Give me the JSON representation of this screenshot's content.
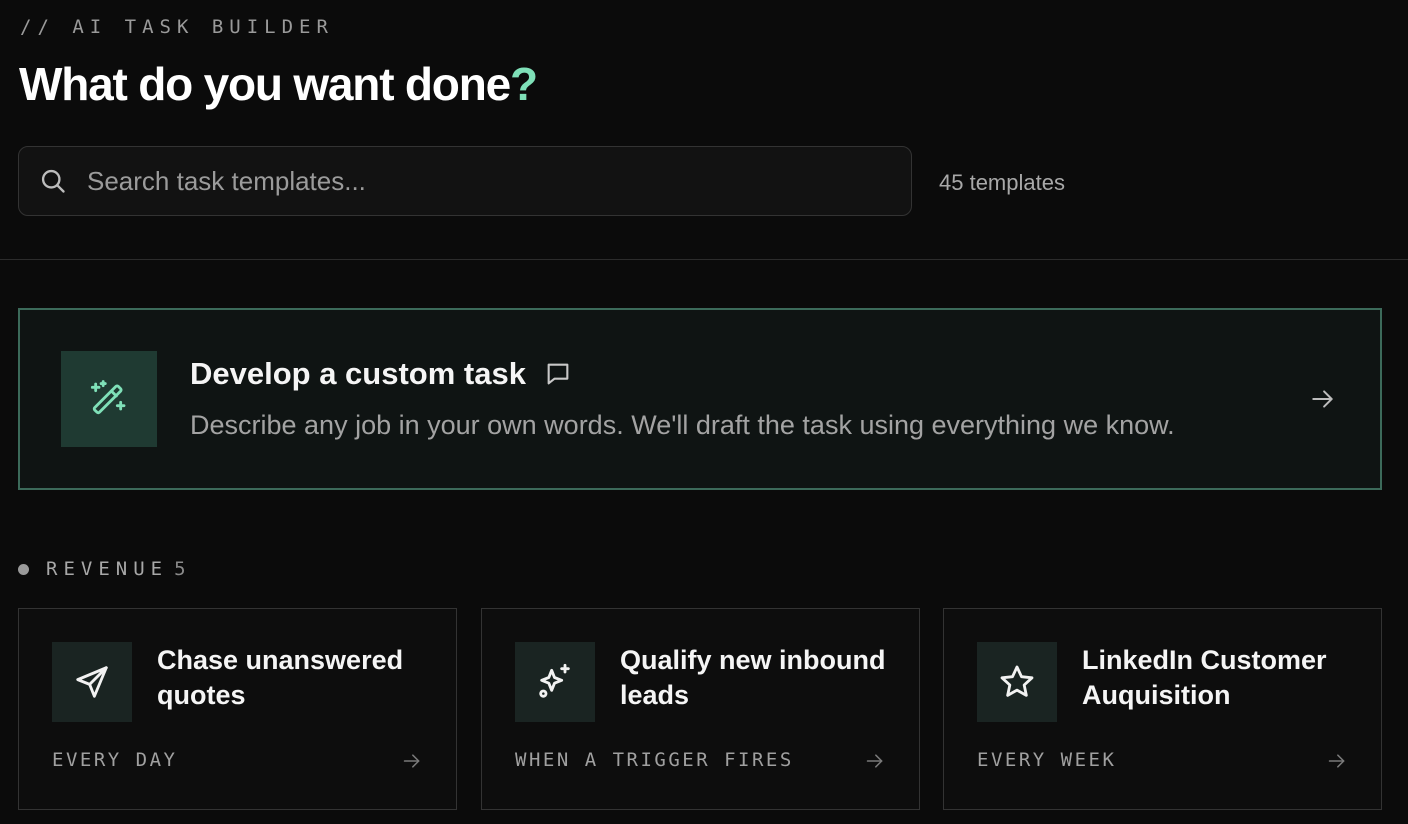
{
  "header": {
    "eyebrow": "// AI TASK BUILDER",
    "title": "What do you want done",
    "title_mark": "?"
  },
  "search": {
    "icon": "search-icon",
    "placeholder": "Search task templates...",
    "value": ""
  },
  "template_count": "45 templates",
  "custom_task": {
    "icon": "magic-wand-icon",
    "title": "Develop a custom task",
    "title_icon": "chat-bubble-icon",
    "description": "Describe any job in your own words. We'll draft the task using everything we know.",
    "arrow_icon": "arrow-right-icon"
  },
  "sections": [
    {
      "label": "REVENUE",
      "count": "5",
      "cards": [
        {
          "icon": "send-icon",
          "title": "Chase unanswered quotes",
          "schedule": "EVERY DAY"
        },
        {
          "icon": "sparkles-icon",
          "title": "Qualify new inbound leads",
          "schedule": "WHEN A TRIGGER FIRES"
        },
        {
          "icon": "star-icon",
          "title": "LinkedIn Customer Auquisition",
          "schedule": "EVERY WEEK"
        }
      ]
    }
  ],
  "colors": {
    "background": "#0b0b0b",
    "accent": "#7fe0b8",
    "accent_border": "#3c6a5a",
    "card_border": "#333333"
  }
}
